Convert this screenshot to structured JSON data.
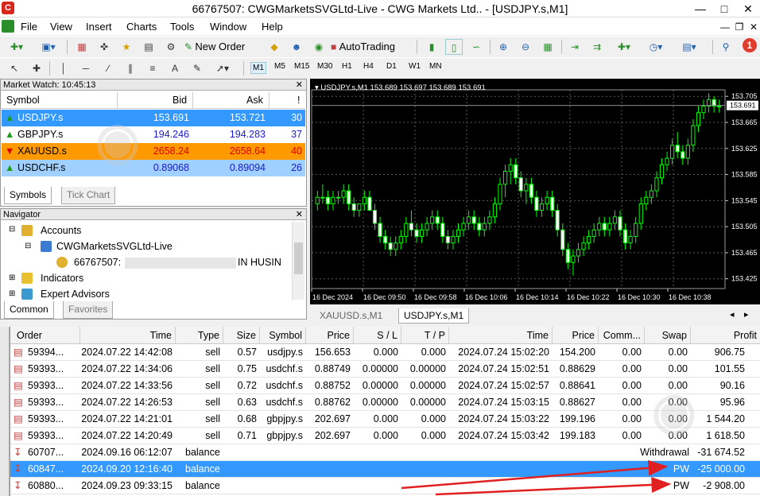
{
  "window": {
    "title": "66767507: CWGMarketsSVGLtd-Live - CWG Markets Ltd.. - [USDJPY.s,M1]",
    "app_icon": "C"
  },
  "menu": [
    "File",
    "View",
    "Insert",
    "Charts",
    "Tools",
    "Window",
    "Help"
  ],
  "toolbar": {
    "new_order": "New Order",
    "autotrading": "AutoTrading",
    "timeframes": [
      "M1",
      "M5",
      "M15",
      "M30",
      "H1",
      "H4",
      "D1",
      "W1",
      "MN"
    ],
    "notification_count": "1"
  },
  "market_watch": {
    "title": "Market Watch: 10:45:13",
    "headers": {
      "symbol": "Symbol",
      "bid": "Bid",
      "ask": "Ask",
      "spread": "!"
    },
    "rows": [
      {
        "symbol": "USDJPY.s",
        "bid": "153.691",
        "ask": "153.721",
        "spread": "30"
      },
      {
        "symbol": "GBPJPY.s",
        "bid": "194.246",
        "ask": "194.283",
        "spread": "37"
      },
      {
        "symbol": "XAUUSD.s",
        "bid": "2658.24",
        "ask": "2658.64",
        "spread": "40"
      },
      {
        "symbol": "USDCHF.s",
        "bid": "0.89068",
        "ask": "0.89094",
        "spread": "26"
      }
    ],
    "tabs": [
      "Symbols",
      "Tick Chart"
    ]
  },
  "navigator": {
    "title": "Navigator",
    "items": {
      "accounts": "Accounts",
      "server": "CWGMarketsSVGLtd-Live",
      "account_prefix": "66767507: ",
      "account_suffix": "IN HUSIN",
      "indicators": "Indicators",
      "experts": "Expert Advisors"
    },
    "tabs": [
      "Common",
      "Favorites"
    ]
  },
  "chart": {
    "header": "USDJPY.s,M1  153.689 153.697 153.689 153.691",
    "price_labels": [
      "153.705",
      "153.665",
      "153.625",
      "153.585",
      "153.545",
      "153.505",
      "153.465",
      "153.425"
    ],
    "current_price": "153.691",
    "time_labels": [
      "16 Dec 2024",
      "16 Dec 09:50",
      "16 Dec 09:58",
      "16 Dec 10:06",
      "16 Dec 10:14",
      "16 Dec 10:22",
      "16 Dec 10:30",
      "16 Dec 10:38"
    ],
    "tabs": [
      "XAUUSD.s,M1",
      "USDJPY.s,M1"
    ]
  },
  "chart_data": {
    "type": "candlestick",
    "title": "USDJPY.s,M1",
    "ylim": [
      153.41,
      153.715
    ],
    "x": [
      "16 Dec 2024",
      "16 Dec 09:50",
      "16 Dec 09:58",
      "16 Dec 10:06",
      "16 Dec 10:14",
      "16 Dec 10:22",
      "16 Dec 10:30",
      "16 Dec 10:38"
    ],
    "ohlc": [
      [
        153.54,
        153.56,
        153.53,
        153.55
      ],
      [
        153.55,
        153.57,
        153.54,
        153.55
      ],
      [
        153.55,
        153.56,
        153.53,
        153.54
      ],
      [
        153.54,
        153.56,
        153.53,
        153.55
      ],
      [
        153.55,
        153.56,
        153.54,
        153.55
      ],
      [
        153.55,
        153.57,
        153.54,
        153.56
      ],
      [
        153.56,
        153.57,
        153.53,
        153.54
      ],
      [
        153.54,
        153.55,
        153.52,
        153.53
      ],
      [
        153.53,
        153.54,
        153.52,
        153.54
      ],
      [
        153.54,
        153.56,
        153.53,
        153.55
      ],
      [
        153.55,
        153.56,
        153.53,
        153.53
      ],
      [
        153.53,
        153.54,
        153.5,
        153.51
      ],
      [
        153.51,
        153.52,
        153.48,
        153.49
      ],
      [
        153.49,
        153.5,
        153.47,
        153.48
      ],
      [
        153.48,
        153.49,
        153.46,
        153.47
      ],
      [
        153.47,
        153.49,
        153.46,
        153.48
      ],
      [
        153.48,
        153.5,
        153.47,
        153.49
      ],
      [
        153.49,
        153.52,
        153.48,
        153.51
      ],
      [
        153.51,
        153.53,
        153.49,
        153.5
      ],
      [
        153.5,
        153.51,
        153.48,
        153.49
      ],
      [
        153.49,
        153.51,
        153.48,
        153.5
      ],
      [
        153.5,
        153.52,
        153.49,
        153.51
      ],
      [
        153.51,
        153.53,
        153.5,
        153.52
      ],
      [
        153.52,
        153.53,
        153.5,
        153.51
      ],
      [
        153.51,
        153.52,
        153.48,
        153.49
      ],
      [
        153.49,
        153.5,
        153.47,
        153.48
      ],
      [
        153.48,
        153.5,
        153.47,
        153.49
      ],
      [
        153.49,
        153.51,
        153.48,
        153.5
      ],
      [
        153.5,
        153.52,
        153.49,
        153.51
      ],
      [
        153.51,
        153.53,
        153.5,
        153.52
      ],
      [
        153.52,
        153.53,
        153.5,
        153.51
      ],
      [
        153.51,
        153.52,
        153.49,
        153.5
      ],
      [
        153.5,
        153.52,
        153.49,
        153.51
      ],
      [
        153.51,
        153.53,
        153.5,
        153.52
      ],
      [
        153.52,
        153.55,
        153.51,
        153.54
      ],
      [
        153.54,
        153.58,
        153.53,
        153.57
      ],
      [
        153.57,
        153.6,
        153.55,
        153.59
      ],
      [
        153.59,
        153.61,
        153.57,
        153.6
      ],
      [
        153.6,
        153.61,
        153.57,
        153.58
      ],
      [
        153.58,
        153.59,
        153.55,
        153.56
      ],
      [
        153.56,
        153.58,
        153.54,
        153.57
      ],
      [
        153.57,
        153.58,
        153.54,
        153.55
      ],
      [
        153.55,
        153.56,
        153.52,
        153.53
      ],
      [
        153.53,
        153.55,
        153.52,
        153.54
      ],
      [
        153.54,
        153.56,
        153.53,
        153.55
      ],
      [
        153.55,
        153.56,
        153.52,
        153.53
      ],
      [
        153.53,
        153.54,
        153.49,
        153.5
      ],
      [
        153.5,
        153.51,
        153.46,
        153.47
      ],
      [
        153.47,
        153.48,
        153.44,
        153.45
      ],
      [
        153.45,
        153.47,
        153.43,
        153.46
      ],
      [
        153.46,
        153.48,
        153.45,
        153.47
      ],
      [
        153.47,
        153.49,
        153.46,
        153.48
      ],
      [
        153.48,
        153.5,
        153.47,
        153.49
      ],
      [
        153.49,
        153.51,
        153.48,
        153.5
      ],
      [
        153.5,
        153.52,
        153.49,
        153.51
      ],
      [
        153.51,
        153.52,
        153.49,
        153.5
      ],
      [
        153.5,
        153.52,
        153.49,
        153.51
      ],
      [
        153.51,
        153.53,
        153.5,
        153.52
      ],
      [
        153.52,
        153.53,
        153.49,
        153.5
      ],
      [
        153.5,
        153.51,
        153.47,
        153.48
      ],
      [
        153.48,
        153.5,
        153.47,
        153.49
      ],
      [
        153.49,
        153.52,
        153.48,
        153.51
      ],
      [
        153.51,
        153.55,
        153.5,
        153.54
      ],
      [
        153.54,
        153.56,
        153.53,
        153.55
      ],
      [
        153.55,
        153.57,
        153.54,
        153.56
      ],
      [
        153.56,
        153.59,
        153.55,
        153.58
      ],
      [
        153.58,
        153.61,
        153.57,
        153.6
      ],
      [
        153.6,
        153.62,
        153.59,
        153.61
      ],
      [
        153.61,
        153.64,
        153.6,
        153.63
      ],
      [
        153.63,
        153.65,
        153.61,
        153.62
      ],
      [
        153.62,
        153.63,
        153.6,
        153.61
      ],
      [
        153.61,
        153.64,
        153.6,
        153.63
      ],
      [
        153.63,
        153.67,
        153.62,
        153.66
      ],
      [
        153.66,
        153.69,
        153.65,
        153.68
      ],
      [
        153.68,
        153.7,
        153.67,
        153.69
      ],
      [
        153.69,
        153.71,
        153.68,
        153.7
      ],
      [
        153.7,
        153.705,
        153.68,
        153.69
      ],
      [
        153.69,
        153.7,
        153.68,
        153.69
      ]
    ]
  },
  "trades": {
    "headers": [
      "Order",
      "Time",
      "Type",
      "Size",
      "Symbol",
      "Price",
      "S / L",
      "T / P",
      "Time",
      "Price",
      "Comm...",
      "Swap",
      "Profit"
    ],
    "rows": [
      {
        "order": "59394...",
        "time": "2024.07.22 14:42:08",
        "type": "sell",
        "size": "0.57",
        "symbol": "usdjpy.s",
        "price": "156.653",
        "sl": "0.000",
        "tp": "0.000",
        "ctime": "2024.07.24 15:02:20",
        "cprice": "154.200",
        "comm": "0.00",
        "swap": "0.00",
        "profit": "906.75"
      },
      {
        "order": "59393...",
        "time": "2024.07.22 14:34:06",
        "type": "sell",
        "size": "0.75",
        "symbol": "usdchf.s",
        "price": "0.88749",
        "sl": "0.00000",
        "tp": "0.00000",
        "ctime": "2024.07.24 15:02:51",
        "cprice": "0.88629",
        "comm": "0.00",
        "swap": "0.00",
        "profit": "101.55"
      },
      {
        "order": "59393...",
        "time": "2024.07.22 14:33:56",
        "type": "sell",
        "size": "0.72",
        "symbol": "usdchf.s",
        "price": "0.88752",
        "sl": "0.00000",
        "tp": "0.00000",
        "ctime": "2024.07.24 15:02:57",
        "cprice": "0.88641",
        "comm": "0.00",
        "swap": "0.00",
        "profit": "90.16"
      },
      {
        "order": "59393...",
        "time": "2024.07.22 14:26:53",
        "type": "sell",
        "size": "0.63",
        "symbol": "usdchf.s",
        "price": "0.88762",
        "sl": "0.00000",
        "tp": "0.00000",
        "ctime": "2024.07.24 15:03:15",
        "cprice": "0.88627",
        "comm": "0.00",
        "swap": "0.00",
        "profit": "95.96"
      },
      {
        "order": "59393...",
        "time": "2024.07.22 14:21:01",
        "type": "sell",
        "size": "0.68",
        "symbol": "gbpjpy.s",
        "price": "202.697",
        "sl": "0.000",
        "tp": "0.000",
        "ctime": "2024.07.24 15:03:22",
        "cprice": "199.196",
        "comm": "0.00",
        "swap": "0.00",
        "profit": "1 544.20"
      },
      {
        "order": "59393...",
        "time": "2024.07.22 14:20:49",
        "type": "sell",
        "size": "0.71",
        "symbol": "gbpjpy.s",
        "price": "202.697",
        "sl": "0.000",
        "tp": "0.000",
        "ctime": "2024.07.24 15:03:42",
        "cprice": "199.183",
        "comm": "0.00",
        "swap": "0.00",
        "profit": "1 618.50"
      }
    ],
    "balances": [
      {
        "order": "60707...",
        "time": "2024.09.16 06:12:07",
        "type": "balance",
        "comment": "Withdrawal",
        "profit": "-31 674.52"
      },
      {
        "order": "60847...",
        "time": "2024.09.20 12:16:40",
        "type": "balance",
        "comment": "PW",
        "profit": "-25 000.00"
      },
      {
        "order": "60880...",
        "time": "2024.09.23 09:33:15",
        "type": "balance",
        "comment": "PW",
        "profit": "-2 908.00"
      }
    ]
  },
  "colors": {
    "selected": "#3399ff",
    "gold_row": "#ff9900",
    "chart_bg": "#000000",
    "bull": "#00ff00",
    "bear": "#ffffff",
    "arrow": "#e02020"
  }
}
